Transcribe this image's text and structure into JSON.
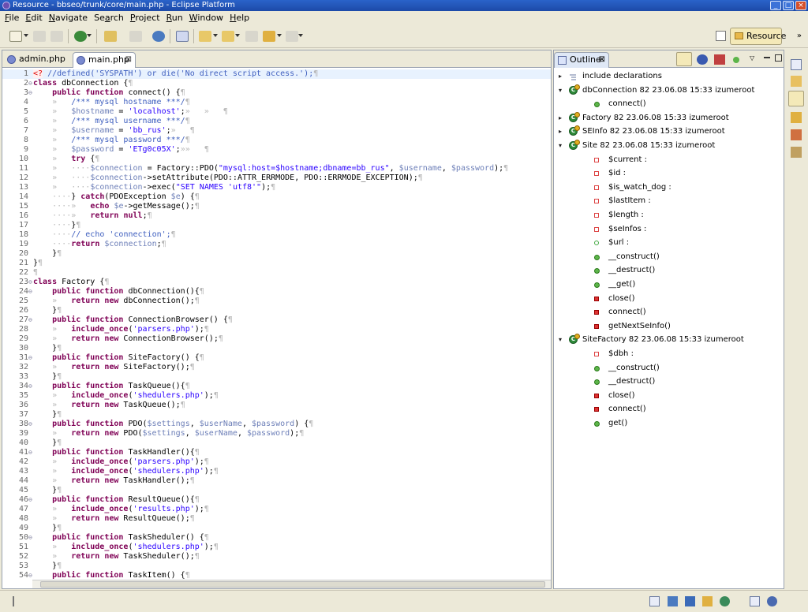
{
  "window": {
    "title": "Resource - bbseo/trunk/core/main.php - Eclipse Platform",
    "buttons": [
      "_",
      "□",
      "×"
    ]
  },
  "menu": [
    {
      "label": "File",
      "mnemonic": "F"
    },
    {
      "label": "Edit",
      "mnemonic": "E"
    },
    {
      "label": "Navigate",
      "mnemonic": "N"
    },
    {
      "label": "Search",
      "mnemonic": "a"
    },
    {
      "label": "Project",
      "mnemonic": "P"
    },
    {
      "label": "Run",
      "mnemonic": "R"
    },
    {
      "label": "Window",
      "mnemonic": "W"
    },
    {
      "label": "Help",
      "mnemonic": "H"
    }
  ],
  "perspective": {
    "label": "Resource"
  },
  "editor": {
    "tabs": [
      {
        "label": "admin.php",
        "active": false
      },
      {
        "label": "main.php",
        "active": true,
        "close": "⊠"
      }
    ],
    "highlight_line": 1,
    "lines": [
      {
        "n": "1",
        "f": "",
        "t": "<? //defined('SYSPATH') or die('No direct script access.');¶"
      },
      {
        "n": "2",
        "f": "⊖",
        "t": "class dbConnection {¶"
      },
      {
        "n": "3",
        "f": "⊖",
        "t": "    public function connect() {¶"
      },
      {
        "n": "4",
        "f": "",
        "t": "    »   /*** mysql hostname ***/¶"
      },
      {
        "n": "5",
        "f": "",
        "t": "    »   $hostname = 'localhost';»   »   ¶"
      },
      {
        "n": "6",
        "f": "",
        "t": "    »   /*** mysql username ***/¶"
      },
      {
        "n": "7",
        "f": "",
        "t": "    »   $username = 'bb_rus';»   ¶"
      },
      {
        "n": "8",
        "f": "",
        "t": "    »   /*** mysql password ***/¶"
      },
      {
        "n": "9",
        "f": "",
        "t": "    »   $password = 'ETg0c05X';»»   ¶"
      },
      {
        "n": "10",
        "f": "",
        "t": "    »   try {¶"
      },
      {
        "n": "11",
        "f": "",
        "t": "    »   ····$connection = Factory::PDO(\"mysql:host=$hostname;dbname=bb_rus\", $username, $password);¶"
      },
      {
        "n": "12",
        "f": "",
        "t": "    »   ····$connection->setAttribute(PDO::ATTR_ERRMODE, PDO::ERRMODE_EXCEPTION);¶"
      },
      {
        "n": "13",
        "f": "",
        "t": "    »   ····$connection->exec(\"SET NAMES 'utf8'\");¶"
      },
      {
        "n": "14",
        "f": "",
        "t": "    ····} catch(PDOException $e) {¶"
      },
      {
        "n": "15",
        "f": "",
        "t": "    ····»   echo $e->getMessage();¶"
      },
      {
        "n": "16",
        "f": "",
        "t": "    ····»   return null;¶"
      },
      {
        "n": "17",
        "f": "",
        "t": "    ····}¶"
      },
      {
        "n": "18",
        "f": "",
        "t": "    ····// echo 'connection';¶"
      },
      {
        "n": "19",
        "f": "",
        "t": "    ····return $connection;¶"
      },
      {
        "n": "20",
        "f": "",
        "t": "    }¶"
      },
      {
        "n": "21",
        "f": "",
        "t": "}¶"
      },
      {
        "n": "22",
        "f": "",
        "t": "¶"
      },
      {
        "n": "23",
        "f": "⊖",
        "t": "class Factory {¶"
      },
      {
        "n": "24",
        "f": "⊖",
        "t": "    public function dbConnection(){¶"
      },
      {
        "n": "25",
        "f": "",
        "t": "    »   return new dbConnection();¶"
      },
      {
        "n": "26",
        "f": "",
        "t": "    }¶"
      },
      {
        "n": "27",
        "f": "⊖",
        "t": "    public function ConnectionBrowser() {¶"
      },
      {
        "n": "28",
        "f": "",
        "t": "    »   include_once('parsers.php');¶"
      },
      {
        "n": "29",
        "f": "",
        "t": "    »   return new ConnectionBrowser();¶"
      },
      {
        "n": "30",
        "f": "",
        "t": "    }¶"
      },
      {
        "n": "31",
        "f": "⊖",
        "t": "    public function SiteFactory() {¶"
      },
      {
        "n": "32",
        "f": "",
        "t": "    »   return new SiteFactory();¶"
      },
      {
        "n": "33",
        "f": "",
        "t": "    }¶"
      },
      {
        "n": "34",
        "f": "⊖",
        "t": "    public function TaskQueue(){¶"
      },
      {
        "n": "35",
        "f": "",
        "t": "    »   include_once('shedulers.php');¶"
      },
      {
        "n": "36",
        "f": "",
        "t": "    »   return new TaskQueue();¶"
      },
      {
        "n": "37",
        "f": "",
        "t": "    }¶"
      },
      {
        "n": "38",
        "f": "⊖",
        "t": "    public function PDO($settings, $userName, $password) {¶"
      },
      {
        "n": "39",
        "f": "",
        "t": "    »   return new PDO($settings, $userName, $password);¶"
      },
      {
        "n": "40",
        "f": "",
        "t": "    }¶"
      },
      {
        "n": "41",
        "f": "⊖",
        "t": "    public function TaskHandler(){¶"
      },
      {
        "n": "42",
        "f": "",
        "t": "    »   include_once('parsers.php');¶"
      },
      {
        "n": "43",
        "f": "",
        "t": "    »   include_once('shedulers.php');¶"
      },
      {
        "n": "44",
        "f": "",
        "t": "    »   return new TaskHandler();¶"
      },
      {
        "n": "45",
        "f": "",
        "t": "    }¶"
      },
      {
        "n": "46",
        "f": "⊖",
        "t": "    public function ResultQueue(){¶"
      },
      {
        "n": "47",
        "f": "",
        "t": "    »   include_once('results.php');¶"
      },
      {
        "n": "48",
        "f": "",
        "t": "    »   return new ResultQueue();¶"
      },
      {
        "n": "49",
        "f": "",
        "t": "    }¶"
      },
      {
        "n": "50",
        "f": "⊖",
        "t": "    public function TaskSheduler() {¶"
      },
      {
        "n": "51",
        "f": "",
        "t": "    »   include_once('shedulers.php');¶"
      },
      {
        "n": "52",
        "f": "",
        "t": "    »   return new TaskSheduler();¶"
      },
      {
        "n": "53",
        "f": "",
        "t": "    }¶"
      },
      {
        "n": "54",
        "f": "⊖",
        "t": "    public function TaskItem() {¶"
      }
    ]
  },
  "outline": {
    "tab_label": "Outline",
    "tab_close": "⊠",
    "nodes": [
      {
        "depth": 0,
        "twist": "▸",
        "icon": "include",
        "label": "include declarations"
      },
      {
        "depth": 0,
        "twist": "▾",
        "icon": "class",
        "label": "dbConnection 82  23.06.08 15:33  izumeroot"
      },
      {
        "depth": 1,
        "twist": "",
        "icon": "method-public",
        "label": "connect()"
      },
      {
        "depth": 0,
        "twist": "▸",
        "icon": "class",
        "label": "Factory 82  23.06.08 15:33  izumeroot"
      },
      {
        "depth": 0,
        "twist": "▸",
        "icon": "class",
        "label": "SEInfo 82  23.06.08 15:33  izumeroot"
      },
      {
        "depth": 0,
        "twist": "▾",
        "icon": "class",
        "label": "Site 82  23.06.08 15:33  izumeroot"
      },
      {
        "depth": 1,
        "twist": "",
        "icon": "field-private",
        "label": "$current :"
      },
      {
        "depth": 1,
        "twist": "",
        "icon": "field-private",
        "label": "$id :"
      },
      {
        "depth": 1,
        "twist": "",
        "icon": "field-private",
        "label": "$is_watch_dog :"
      },
      {
        "depth": 1,
        "twist": "",
        "icon": "field-private",
        "label": "$lastItem :"
      },
      {
        "depth": 1,
        "twist": "",
        "icon": "field-private",
        "label": "$length :"
      },
      {
        "depth": 1,
        "twist": "",
        "icon": "field-private",
        "label": "$seInfos :"
      },
      {
        "depth": 1,
        "twist": "",
        "icon": "field-public",
        "label": "$url :"
      },
      {
        "depth": 1,
        "twist": "",
        "icon": "method-public",
        "label": "__construct()"
      },
      {
        "depth": 1,
        "twist": "",
        "icon": "method-public",
        "label": "__destruct()"
      },
      {
        "depth": 1,
        "twist": "",
        "icon": "method-public",
        "label": "__get()"
      },
      {
        "depth": 1,
        "twist": "",
        "icon": "method-private",
        "label": "close()"
      },
      {
        "depth": 1,
        "twist": "",
        "icon": "method-private",
        "label": "connect()"
      },
      {
        "depth": 1,
        "twist": "",
        "icon": "method-private",
        "label": "getNextSeInfo()"
      },
      {
        "depth": 0,
        "twist": "▾",
        "icon": "class",
        "label": "SiteFactory 82  23.06.08 15:33  izumeroot"
      },
      {
        "depth": 1,
        "twist": "",
        "icon": "field-private",
        "label": "$dbh :"
      },
      {
        "depth": 1,
        "twist": "",
        "icon": "method-public",
        "label": "__construct()"
      },
      {
        "depth": 1,
        "twist": "",
        "icon": "method-public",
        "label": "__destruct()"
      },
      {
        "depth": 1,
        "twist": "",
        "icon": "method-private",
        "label": "close()"
      },
      {
        "depth": 1,
        "twist": "",
        "icon": "method-private",
        "label": "connect()"
      },
      {
        "depth": 1,
        "twist": "",
        "icon": "method-public",
        "label": "get()"
      }
    ]
  },
  "colors": {
    "keyword": "#7f0055",
    "string": "#2a00ff",
    "variable": "#6d7fb8",
    "comment": "#3f5fbf"
  }
}
